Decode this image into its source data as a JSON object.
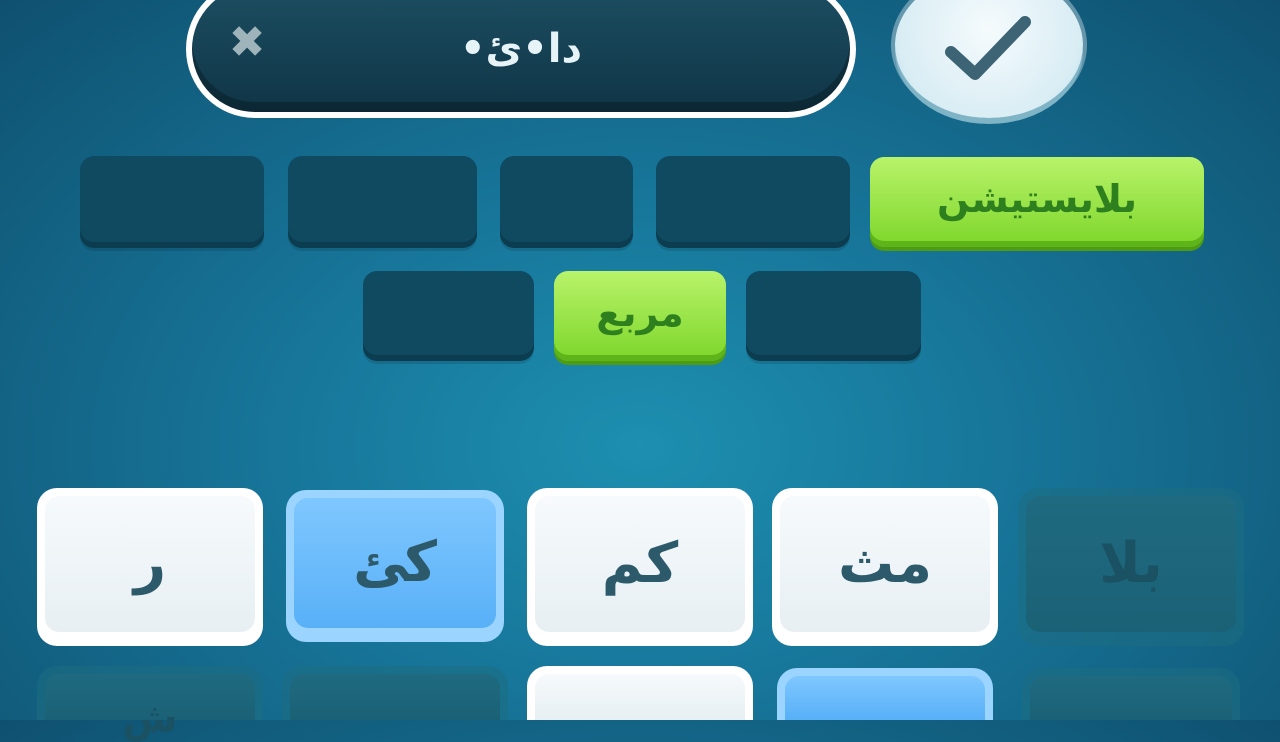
{
  "answer": {
    "text": "دا•ئ•",
    "clear_icon": "close-icon",
    "confirm_icon": "checkmark-icon"
  },
  "slots": {
    "row1": [
      {
        "text": "",
        "state": "empty"
      },
      {
        "text": "",
        "state": "empty"
      },
      {
        "text": "",
        "state": "empty"
      },
      {
        "text": "",
        "state": "empty"
      },
      {
        "text": "بلايستيشن",
        "state": "solved"
      }
    ],
    "row2": [
      {
        "text": "",
        "state": "empty"
      },
      {
        "text": "مربع",
        "state": "solved"
      },
      {
        "text": "",
        "state": "empty"
      }
    ]
  },
  "keys": {
    "row1": [
      {
        "label": "ر",
        "state": "normal"
      },
      {
        "label": "كئ",
        "state": "selected"
      },
      {
        "label": "كم",
        "state": "normal"
      },
      {
        "label": "مث",
        "state": "normal"
      },
      {
        "label": "بلا",
        "state": "used"
      }
    ],
    "row2": [
      {
        "label": "ش",
        "state": "used"
      },
      {
        "label": "",
        "state": "used"
      },
      {
        "label": "",
        "state": "normal"
      },
      {
        "label": "",
        "state": "selected"
      },
      {
        "label": "",
        "state": "used"
      }
    ]
  },
  "colors": {
    "background": "#17769a",
    "slot_empty": "#0f4a61",
    "slot_solved": "#7dd62a",
    "key_selected": "#58b0f7"
  }
}
